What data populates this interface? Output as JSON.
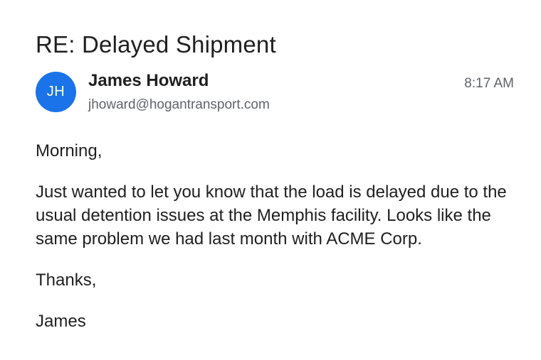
{
  "email": {
    "subject": "RE: Delayed Shipment",
    "sender": {
      "initials": "JH",
      "name": "James Howard",
      "address": "jhoward@hogantransport.com",
      "avatar_color": "#1a73e8"
    },
    "time": "8:17 AM",
    "body": {
      "greeting": "Morning,",
      "paragraph": "Just wanted to let you know that the load is delayed due to the usual detention issues at the Memphis facility. Looks like the same problem we had last month with ACME Corp.",
      "closing": "Thanks,",
      "signature": "James"
    }
  }
}
